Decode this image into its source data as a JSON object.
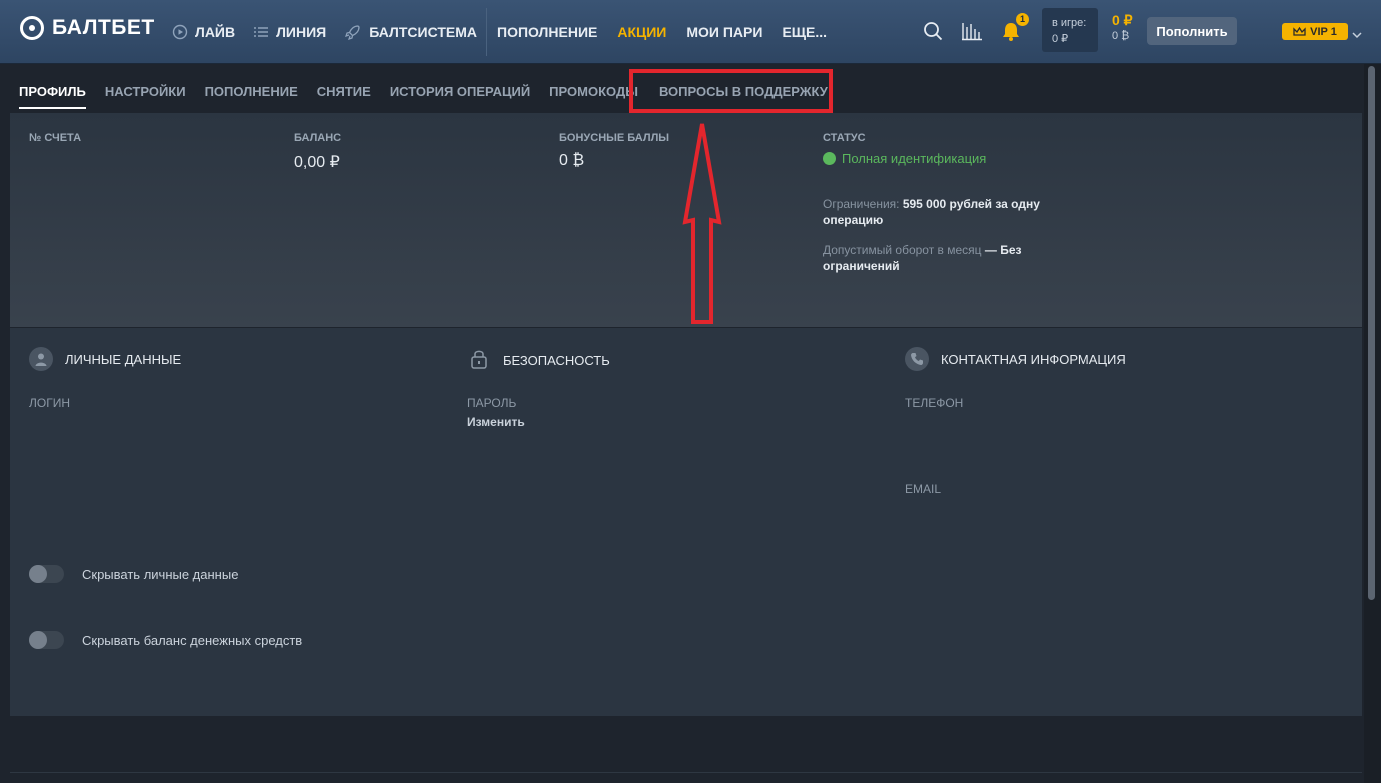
{
  "header": {
    "logo_text": "БАЛТБЕТ",
    "nav_primary": [
      {
        "label": "ЛАЙВ",
        "icon": "play-circle-icon"
      },
      {
        "label": "ЛИНИЯ",
        "icon": "list-icon"
      },
      {
        "label": "БАЛТСИСТЕМА",
        "icon": "rocket-icon"
      }
    ],
    "nav_secondary": [
      {
        "label": "ПОПОЛНЕНИЕ"
      },
      {
        "label": "АКЦИИ"
      },
      {
        "label": "МОИ ПАРИ"
      },
      {
        "label": "ЕЩЕ..."
      }
    ],
    "notifications_count": "1",
    "in_game_label": "в игре:",
    "in_game_value": "0 ₽",
    "balance_main": "0 ₽",
    "balance_bonus": "0 ₿",
    "topup_label": "Пополнить",
    "vip_label": "VIP 1",
    "accent_color": "#f5b300"
  },
  "tabs": [
    {
      "label": "ПРОФИЛЬ"
    },
    {
      "label": "НАСТРОЙКИ"
    },
    {
      "label": "ПОПОЛНЕНИЕ"
    },
    {
      "label": "СНЯТИЕ"
    },
    {
      "label": "ИСТОРИЯ ОПЕРАЦИЙ"
    },
    {
      "label": "ПРОМОКОДЫ"
    },
    {
      "label": "ВОПРОСЫ В ПОДДЕРЖКУ"
    }
  ],
  "summary": {
    "account_label": "№ СЧЕТА",
    "balance_label": "БАЛАНС",
    "balance_value": "0,00 ₽",
    "bonus_label": "БОНУСНЫЕ БАЛЛЫ",
    "bonus_value": "0 ₿",
    "status_label": "СТАТУС",
    "status_value": "Полная идентификация",
    "limit_label": "Ограничения:",
    "limit_value": "595 000 рублей за одну операцию",
    "turnover_label": "Допустимый оборот в месяц",
    "turnover_value": "— Без ограничений"
  },
  "profile": {
    "personal_title": "ЛИЧНЫЕ ДАННЫЕ",
    "security_title": "БЕЗОПАСНОСТЬ",
    "contact_title": "КОНТАКТНАЯ ИНФОРМАЦИЯ",
    "login_label": "ЛОГИН",
    "password_label": "ПАРОЛЬ",
    "password_change": "Изменить",
    "phone_label": "ТЕЛЕФОН",
    "email_label": "EMAIL",
    "hide_personal": "Скрывать личные данные",
    "hide_balance": "Скрывать баланс денежных средств"
  },
  "annotation_color": "#e3262d"
}
